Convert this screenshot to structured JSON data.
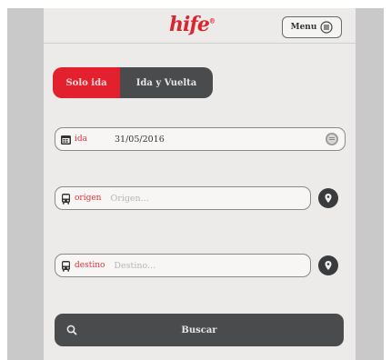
{
  "header": {
    "logo_text": "hife",
    "logo_mark": "®",
    "menu_label": "Menu",
    "menu_icon": "menu-circle-icon"
  },
  "trip_type": {
    "options": [
      "Solo ida",
      "Ida y Vuelta"
    ],
    "selected": "Solo ida"
  },
  "form": {
    "date": {
      "label": "ida",
      "value": "31/05/2016",
      "icon": "calendar-icon",
      "action_icon": "chevron-circle-icon"
    },
    "origin": {
      "label": "origen",
      "placeholder": "Origen...",
      "icon": "bus-icon",
      "action_icon": "location-pin-icon"
    },
    "destination": {
      "label": "destino",
      "placeholder": "Destino...",
      "icon": "bus-icon",
      "action_icon": "location-pin-icon"
    }
  },
  "search": {
    "label": "Buscar",
    "icon": "search-icon"
  },
  "colors": {
    "accent": "#e3212e",
    "dark": "#4a4b4d",
    "background": "#ecebea",
    "frame": "#c9c9c9"
  }
}
